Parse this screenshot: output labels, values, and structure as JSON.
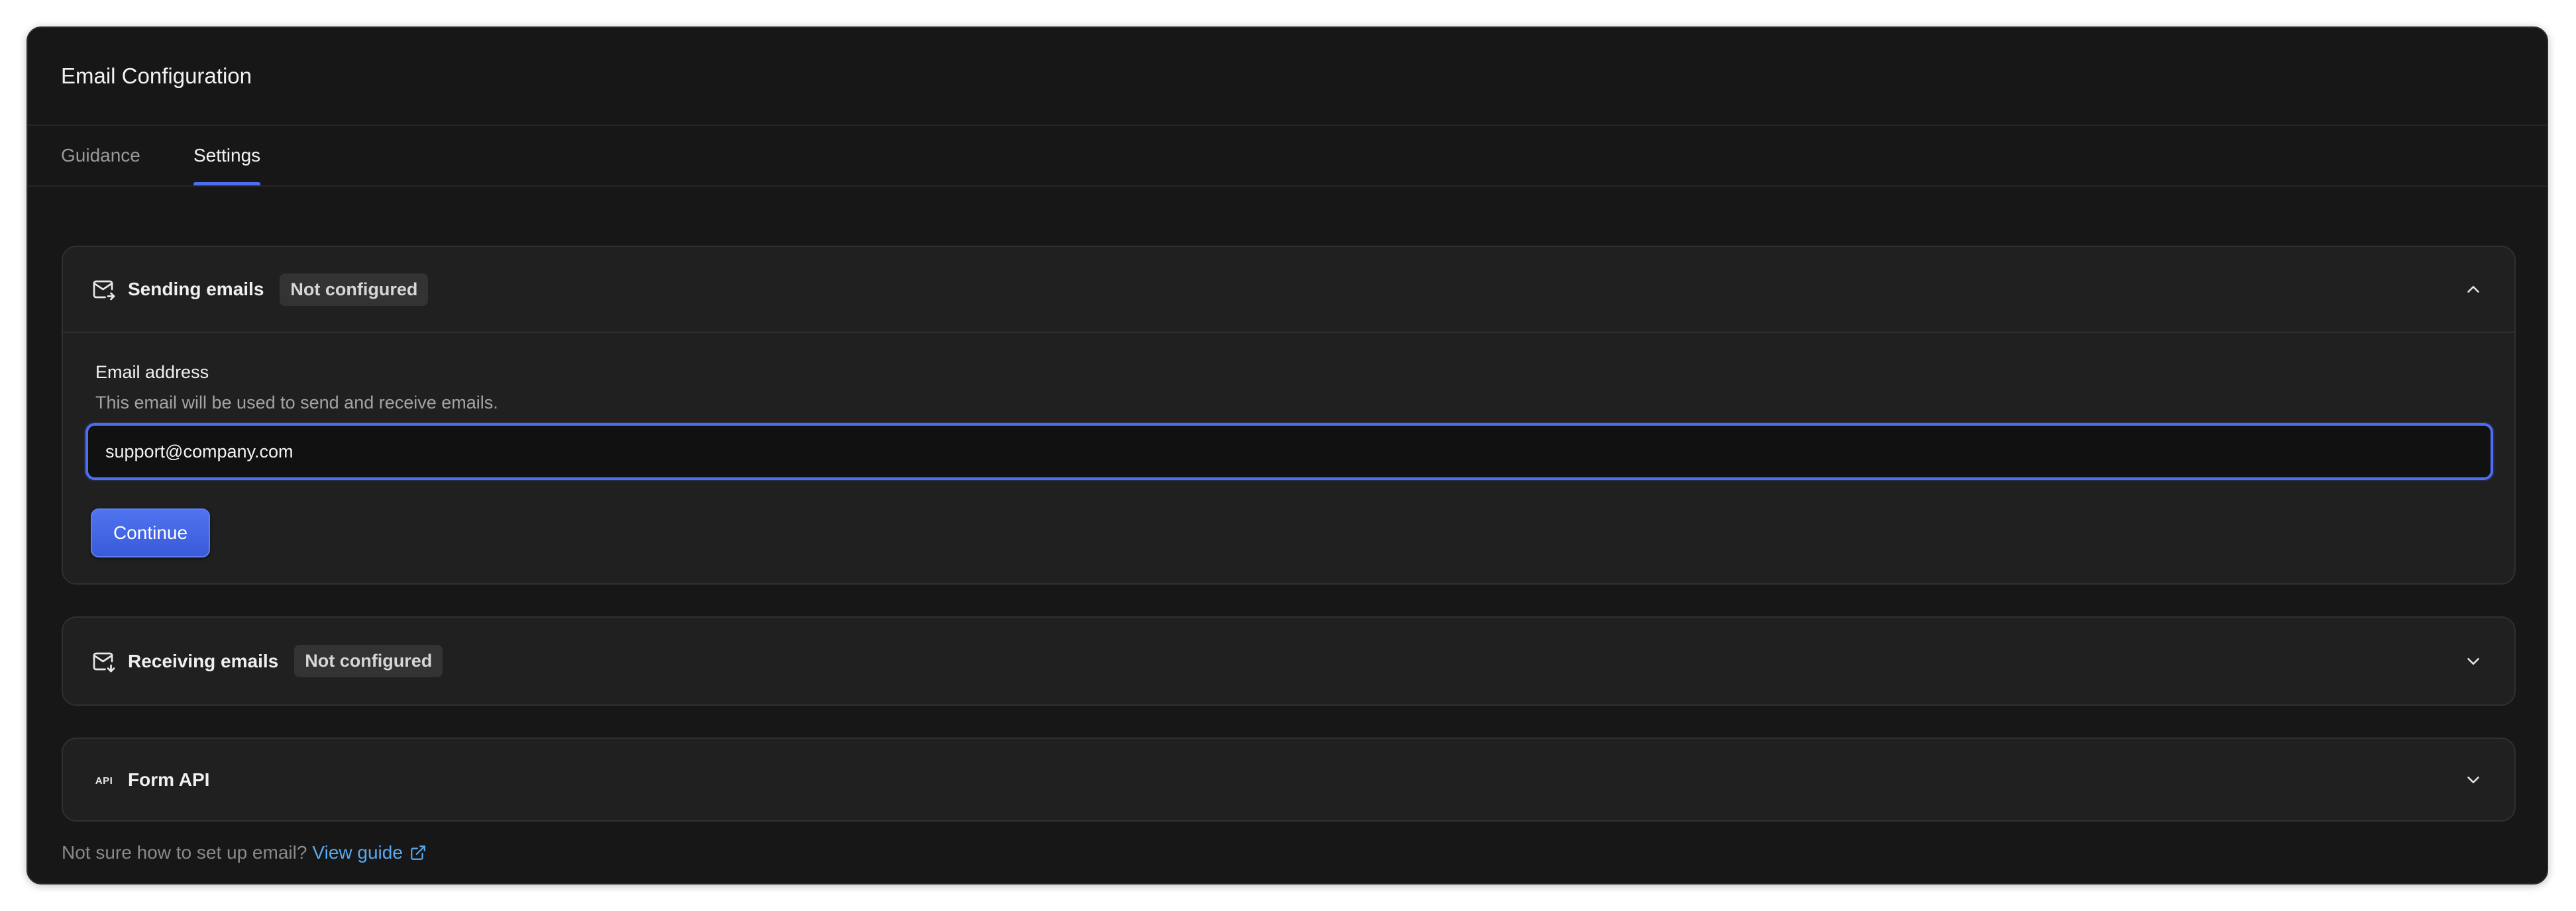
{
  "header": {
    "title": "Email Configuration"
  },
  "tabs": [
    {
      "label": "Guidance",
      "active": false
    },
    {
      "label": "Settings",
      "active": true
    }
  ],
  "sections": {
    "sending": {
      "title": "Sending emails",
      "badge": "Not configured",
      "expanded": true,
      "icon": "mail-send-icon",
      "field": {
        "label": "Email address",
        "help": "This email will be used to send and receive emails.",
        "value": "support@company.com"
      },
      "continue_label": "Continue"
    },
    "receiving": {
      "title": "Receiving emails",
      "badge": "Not configured",
      "expanded": false,
      "icon": "mail-receive-icon"
    },
    "form_api": {
      "title": "Form API",
      "expanded": false,
      "icon": "api-icon",
      "icon_text": "API"
    }
  },
  "footer": {
    "text": "Not sure how to set up email?",
    "link_label": "View guide"
  },
  "colors": {
    "accent": "#4e6ef2",
    "link": "#5aa9f0",
    "background": "#171717",
    "card": "#202020"
  }
}
